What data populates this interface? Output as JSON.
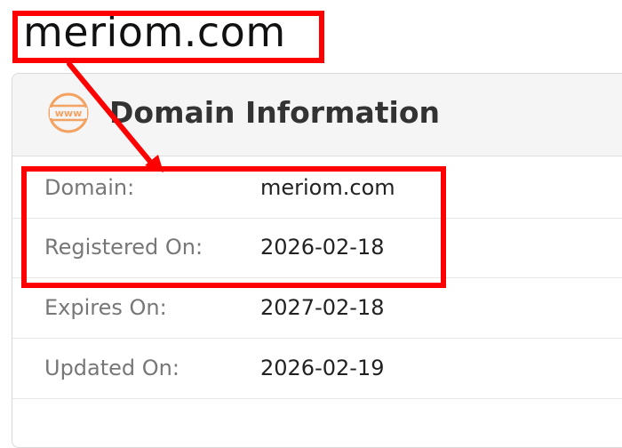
{
  "page": {
    "heading": "meriom.com"
  },
  "card": {
    "title": "Domain Information",
    "icon_text": "www",
    "icon": "www-globe-icon",
    "rows": [
      {
        "label": "Domain:",
        "value": "meriom.com"
      },
      {
        "label": "Registered On:",
        "value": "2026-02-18"
      },
      {
        "label": "Expires On:",
        "value": "2027-02-18"
      },
      {
        "label": "Updated On:",
        "value": "2026-02-19"
      }
    ]
  },
  "colors": {
    "highlight": "#ff0000",
    "icon_accent": "#f4a261",
    "header_bg": "#f5f5f5",
    "label": "#777777",
    "value": "#222222"
  }
}
